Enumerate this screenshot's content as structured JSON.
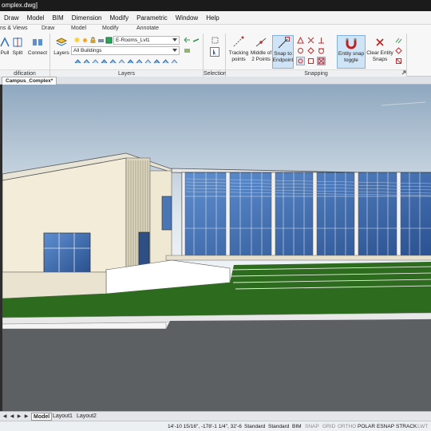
{
  "title": "Campus_Complex.dwg",
  "title_visible": "omplex.dwg]",
  "menu": [
    "Draw",
    "Model",
    "BIM",
    "Dimension",
    "Modify",
    "Parametric",
    "Window",
    "Help"
  ],
  "ribbon_tabs": {
    "col1": "ns & Views",
    "draw": "Draw",
    "model": "Model",
    "modify": "Modify",
    "annotate": "Annotate"
  },
  "modification_group": {
    "label": "dification",
    "tools": [
      "Pull",
      "Split",
      "Connect"
    ]
  },
  "layers_group": {
    "label": "Layers",
    "tool_label": "Layers",
    "current_layer": "E-Rooms_Lvl1",
    "filter": "All Buildings"
  },
  "selection_group": {
    "label": "Selection"
  },
  "snapping_group": {
    "label": "Snapping",
    "tools": [
      {
        "label": "Tracking\npoints",
        "active": false
      },
      {
        "label": "Middle of\n2 Points",
        "active": false
      },
      {
        "label": "Snap to\nEndpoint",
        "active": true
      },
      {
        "label": "Entity snap\ntoggle",
        "active": true
      },
      {
        "label": "Clear Entity\nSnaps",
        "active": false
      }
    ]
  },
  "document_tab": "Campus_Complex*",
  "layout_tabs": [
    "Model",
    "Layout1",
    "Layout2"
  ],
  "active_layout": "Model",
  "status": {
    "coordinates": "14'-10 15/16\", -178'-1 1/4\", 32'-6",
    "items": [
      {
        "label": "Standard",
        "on": true
      },
      {
        "label": "Standard",
        "on": true
      },
      {
        "label": "BIM",
        "on": true
      },
      {
        "label": "SNAP",
        "on": false
      },
      {
        "label": "GRID",
        "on": false
      },
      {
        "label": "ORTHO",
        "on": false
      },
      {
        "label": "POLAR",
        "on": true
      },
      {
        "label": "ESNAP",
        "on": true
      },
      {
        "label": "STRACK",
        "on": true
      },
      {
        "label": "LWT",
        "on": false
      }
    ]
  },
  "colors": {
    "sky_top": "#8fa8bf",
    "sky_bottom": "#ffffff",
    "grass": "#2d6b1e",
    "road": "#5c6063",
    "glass": "#3f6fb5",
    "wall": "#f2ecd8",
    "accent": "#7fb2e0"
  }
}
